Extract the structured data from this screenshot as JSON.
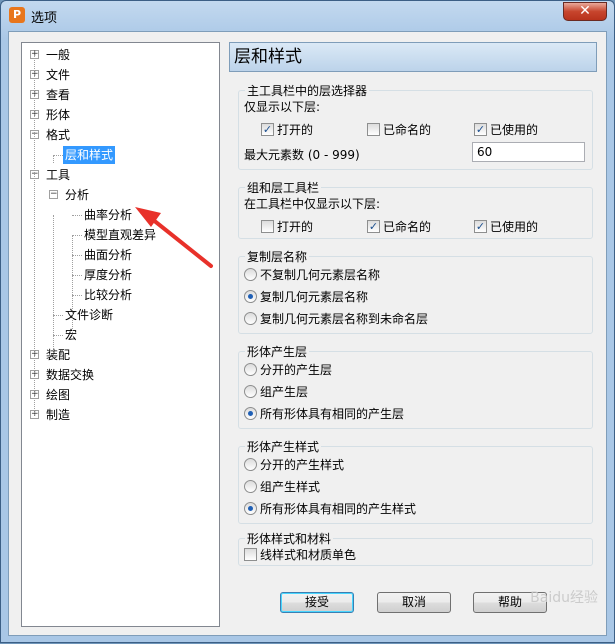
{
  "window": {
    "title": "选项",
    "app_icon": "P",
    "close_glyph": "✕"
  },
  "tree": {
    "items": [
      {
        "label": "一般",
        "expander": "+"
      },
      {
        "label": "文件",
        "expander": "+"
      },
      {
        "label": "查看",
        "expander": "+"
      },
      {
        "label": "形体",
        "expander": "+"
      },
      {
        "label": "格式",
        "expander": "−"
      },
      {
        "label": "层和样式"
      },
      {
        "label": "工具",
        "expander": "−"
      },
      {
        "label": "分析",
        "expander": "−"
      },
      {
        "label": "曲率分析"
      },
      {
        "label": "模型直观差异"
      },
      {
        "label": "曲面分析"
      },
      {
        "label": "厚度分析"
      },
      {
        "label": "比较分析"
      },
      {
        "label": "文件诊断"
      },
      {
        "label": "宏"
      },
      {
        "label": "装配",
        "expander": "+"
      },
      {
        "label": "数据交换",
        "expander": "+"
      },
      {
        "label": "绘图",
        "expander": "+"
      },
      {
        "label": "制造",
        "expander": "+"
      }
    ]
  },
  "panel": {
    "title": "层和样式",
    "main_toolbar": {
      "title": "主工具栏中的层选择器",
      "subtitle": "仅显示以下层:",
      "opt_open": "打开的",
      "opt_open_checked": true,
      "opt_named": "已命名的",
      "opt_named_checked": false,
      "opt_used": "已使用的",
      "opt_used_checked": true,
      "max_label": "最大元素数 (0 - 999)",
      "max_value": "60"
    },
    "group_toolbar": {
      "title": "组和层工具栏",
      "subtitle": "在工具栏中仅显示以下层:",
      "opt_open": "打开的",
      "opt_open_checked": false,
      "opt_named": "已命名的",
      "opt_named_checked": true,
      "opt_used": "已使用的",
      "opt_used_checked": true
    },
    "copy_layer_name": {
      "title": "复制层名称",
      "options": [
        "不复制几何元素层名称",
        "复制几何元素层名称",
        "复制几何元素层名称到未命名层"
      ],
      "selected": 1
    },
    "body_layer": {
      "title": "形体产生层",
      "options": [
        "分开的产生层",
        "组产生层",
        "所有形体具有相同的产生层"
      ],
      "selected": 2
    },
    "body_style": {
      "title": "形体产生样式",
      "options": [
        "分开的产生样式",
        "组产生样式",
        "所有形体具有相同的产生样式"
      ],
      "selected": 2
    },
    "body_material": {
      "title": "形体样式和材料",
      "mono_label": "线样式和材质单色",
      "mono_checked": false
    }
  },
  "buttons": {
    "ok": "接受",
    "cancel": "取消",
    "help": "帮助"
  },
  "watermark": "Baidu经验",
  "colors": {
    "selection": "#3399ff",
    "arrow": "#e8312a"
  }
}
